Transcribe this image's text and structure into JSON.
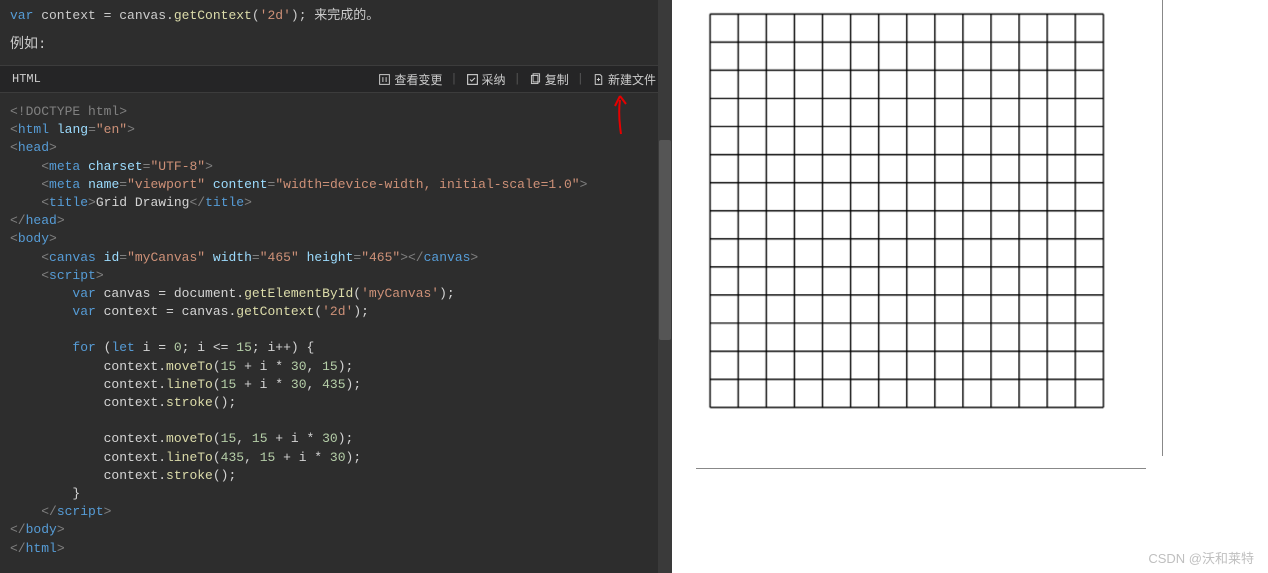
{
  "top_snippet": {
    "prefix_kw": "var",
    "prefix_rest": " context = canvas.",
    "prefix_fn": "getContext",
    "prefix_arg": "'2d'",
    "prefix_tail": "); ",
    "suffix_cn": "来完成的。"
  },
  "example_label": "例如:",
  "header": {
    "title": "HTML",
    "actions": {
      "view_changes": "查看变更",
      "accept": "采纳",
      "copy": "复制",
      "new_file": "新建文件"
    }
  },
  "code": {
    "l01_doctype": "<!DOCTYPE html>",
    "l02_html_open_tag": "html",
    "l02_attr_lang": "lang",
    "l02_val_lang": "\"en\"",
    "l03_head": "head",
    "l04_meta": "meta",
    "l04_charset_attr": "charset",
    "l04_charset_val": "\"UTF-8\"",
    "l05_meta": "meta",
    "l05_name_attr": "name",
    "l05_name_val": "\"viewport\"",
    "l05_content_attr": "content",
    "l05_content_val": "\"width=device-width, initial-scale=1.0\"",
    "l06_title": "title",
    "l06_title_text": "Grid Drawing",
    "l08_body": "body",
    "l09_canvas": "canvas",
    "l09_id_attr": "id",
    "l09_id_val": "\"myCanvas\"",
    "l09_w_attr": "width",
    "l09_w_val": "\"465\"",
    "l09_h_attr": "height",
    "l09_h_val": "\"465\"",
    "l10_script": "script",
    "l11_var": "var",
    "l11_canvas": " canvas = document.",
    "l11_fn": "getElementById",
    "l11_arg": "'myCanvas'",
    "l12_var": "var",
    "l12_ctx": " context = canvas.",
    "l12_fn": "getContext",
    "l12_arg": "'2d'",
    "l14_for": "for",
    "l14_let": "let",
    "l14_rest1": " i = ",
    "l14_n0": "0",
    "l14_rest2": "; i <= ",
    "l14_n15": "15",
    "l14_rest3": "; i++) {",
    "l15_pre": "context.",
    "l15_fn": "moveTo",
    "l15_a1": "15",
    "l15_mid1": " + i * ",
    "l15_a2": "30",
    "l15_mid2": ", ",
    "l15_a3": "15",
    "l16_fn": "lineTo",
    "l16_a1": "15",
    "l16_a2": "30",
    "l16_a3": "435",
    "l17_fn": "stroke",
    "l19_fn": "moveTo",
    "l19_a1": "15",
    "l19_a2": "15",
    "l19_a3": "30",
    "l20_fn": "lineTo",
    "l20_a1": "435",
    "l20_a2": "15",
    "l20_a3": "30",
    "l21_fn": "stroke",
    "l22_brace": "}"
  },
  "watermark": "CSDN @沃和莱特",
  "chart_data": {
    "type": "grid",
    "description": "Square canvas grid output — 14×14 cells (15 vertical + 15 horizontal black lines), drawn by loop from 15 to 435 step 30.",
    "canvas_size": 465,
    "line_count": 15,
    "start": 15,
    "step": 30,
    "end": 435,
    "stroke": "#000000"
  }
}
